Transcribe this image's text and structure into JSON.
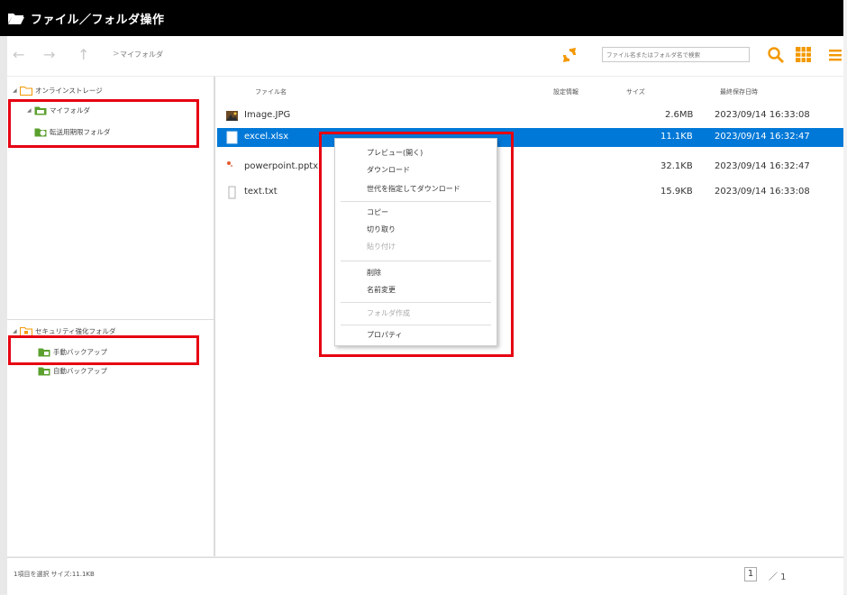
{
  "window": {
    "title": "ファイル／フォルダ操作"
  },
  "toolbar": {
    "breadcrumb": "マイフォルダ",
    "search_placeholder": "ファイル名またはフォルダ名で検索"
  },
  "sidebar": {
    "top": {
      "root": "オンラインストレージ",
      "items": [
        "マイフォルダ",
        "転送用期限フォルダ"
      ]
    },
    "bottom": {
      "root": "セキュリティ強化フォルダ",
      "items": [
        "手動バックアップ",
        "自動バックアップ"
      ]
    }
  },
  "file_list": {
    "columns": [
      "ファイル名",
      "設定情報",
      "サイズ",
      "最終保存日時"
    ],
    "rows": [
      {
        "name": "Image.JPG",
        "settings": "",
        "size": "2.6MB",
        "modified": "2023/09/14 16:33:08",
        "icon": "image-file-icon",
        "selected": false
      },
      {
        "name": "excel.xlsx",
        "settings": "",
        "size": "11.1KB",
        "modified": "2023/09/14 16:32:47",
        "icon": "excel-file-icon",
        "selected": true
      },
      {
        "name": "powerpoint.pptx",
        "settings": "",
        "size": "32.1KB",
        "modified": "2023/09/14 16:32:47",
        "icon": "powerpoint-file-icon",
        "selected": false
      },
      {
        "name": "text.txt",
        "settings": "",
        "size": "15.9KB",
        "modified": "2023/09/14 16:33:08",
        "icon": "text-file-icon",
        "selected": false
      }
    ]
  },
  "context_menu": {
    "items": [
      {
        "label": "プレビュー(開く)",
        "disabled": false
      },
      {
        "label": "ダウンロード",
        "disabled": false
      },
      {
        "label": "世代を指定してダウンロード",
        "disabled": false
      },
      {
        "label": "コピー",
        "disabled": false
      },
      {
        "label": "切り取り",
        "disabled": false
      },
      {
        "label": "貼り付け",
        "disabled": true
      },
      {
        "label": "削除",
        "disabled": false
      },
      {
        "label": "名前変更",
        "disabled": false
      },
      {
        "label": "フォルダ作成",
        "disabled": true
      },
      {
        "label": "プロパティ",
        "disabled": false
      }
    ]
  },
  "status": {
    "selection": "1項目を選択 サイズ:11.1KB",
    "page_current": "1",
    "page_total": "／ 1"
  },
  "colors": {
    "titlebar": "#000000",
    "selection": "#0078d7",
    "highlight_box": "#e60012",
    "accent_orange": "#f39800",
    "folder_green": "#5aa02c"
  }
}
